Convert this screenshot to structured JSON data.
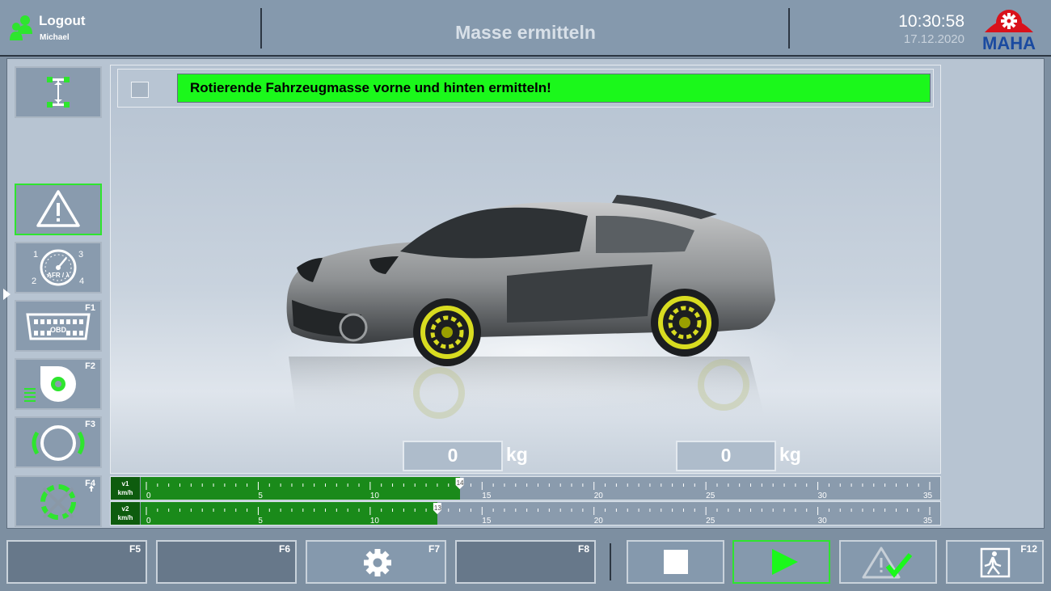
{
  "header": {
    "logout_label": "Logout",
    "user_name": "Michael",
    "title": "Masse ermitteln",
    "time": "10:30:58",
    "date": "17.12.2020",
    "logo_text": "MAHA"
  },
  "left_toolbar": {
    "items": [
      {
        "name": "axle-measure",
        "key": ""
      },
      {
        "name": "warning",
        "key": ""
      },
      {
        "name": "afr-lambda-gauge",
        "key": "",
        "gauge_label": "AFR / λ",
        "gauge_numbers": [
          "1",
          "2",
          "3",
          "4"
        ]
      },
      {
        "name": "obd",
        "key": "F1",
        "label": "OBD"
      },
      {
        "name": "blower",
        "key": "F2"
      },
      {
        "name": "tire",
        "key": "F3"
      },
      {
        "name": "recycle",
        "key": "F4"
      }
    ]
  },
  "message": {
    "text": "Rotierende Fahrzeugmasse vorne und hinten ermitteln!",
    "checked": false
  },
  "mass": {
    "front_value": "0",
    "rear_value": "0",
    "unit": "kg"
  },
  "speed_bars": {
    "unit": "km/h",
    "scale": {
      "min": 0,
      "max": 35,
      "labels": [
        "0",
        "5",
        "10",
        "15",
        "20",
        "25",
        "30",
        "35"
      ]
    },
    "rows": [
      {
        "label": "v1",
        "value": 14,
        "marker": "14"
      },
      {
        "label": "v2",
        "value": 13,
        "marker": "13"
      }
    ]
  },
  "bottom_bar": {
    "buttons": [
      {
        "key": "F5"
      },
      {
        "key": "F6"
      },
      {
        "key": "F7",
        "icon": "gear-icon"
      },
      {
        "key": "F8"
      },
      {
        "key": "",
        "icon": "stop-icon"
      },
      {
        "key": "",
        "icon": "play-icon"
      },
      {
        "key": "",
        "icon": "warning-check-icon"
      },
      {
        "key": "F12",
        "icon": "exit-icon"
      }
    ]
  },
  "colors": {
    "accent_green": "#1bf81b",
    "bar_green": "#1a8a1a",
    "header_bg": "#8599ad",
    "maha_red": "#d9121b",
    "maha_blue": "#1a4aa0"
  }
}
